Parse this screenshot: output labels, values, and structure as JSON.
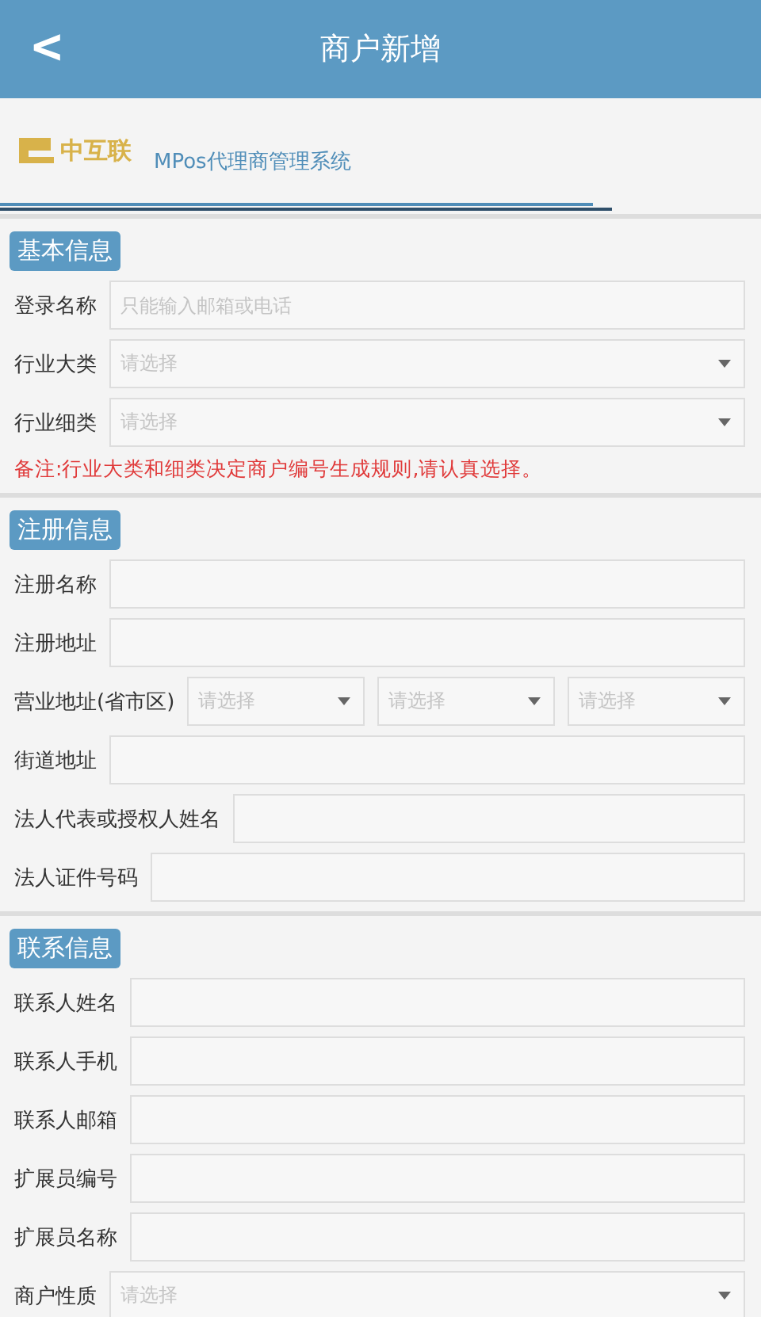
{
  "header": {
    "back": "<",
    "title": "商户新增"
  },
  "brand": {
    "logo_text": "中互联",
    "system_name": "MPos代理商管理系统"
  },
  "sections": [
    {
      "title": "基本信息",
      "fields": [
        {
          "kind": "text",
          "label": "登录名称",
          "placeholder": "只能输入邮箱或电话"
        },
        {
          "kind": "select",
          "label": "行业大类",
          "placeholder": "请选择"
        },
        {
          "kind": "select",
          "label": "行业细类",
          "placeholder": "请选择"
        }
      ],
      "note": "备注:行业大类和细类决定商户编号生成规则,请认真选择。"
    },
    {
      "title": "注册信息",
      "fields": [
        {
          "kind": "text",
          "label": "注册名称"
        },
        {
          "kind": "text",
          "label": "注册地址"
        },
        {
          "kind": "selects",
          "label": "营业地址(省市区)",
          "placeholders": [
            "请选择",
            "请选择",
            "请选择"
          ]
        },
        {
          "kind": "text",
          "label": "街道地址"
        },
        {
          "kind": "text",
          "label": "法人代表或授权人姓名"
        },
        {
          "kind": "text",
          "label": "法人证件号码"
        }
      ]
    },
    {
      "title": "联系信息",
      "fields": [
        {
          "kind": "text",
          "label": "联系人姓名"
        },
        {
          "kind": "text",
          "label": "联系人手机"
        },
        {
          "kind": "text",
          "label": "联系人邮箱"
        },
        {
          "kind": "text",
          "label": "扩展员编号"
        },
        {
          "kind": "text",
          "label": "扩展员名称"
        },
        {
          "kind": "select",
          "label": "商户性质",
          "placeholder": "请选择"
        }
      ]
    }
  ]
}
